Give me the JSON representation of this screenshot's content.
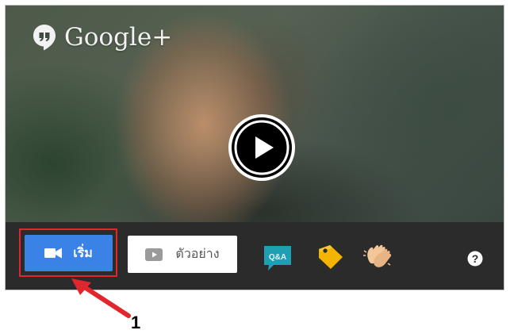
{
  "header": {
    "brand_name": "Google+"
  },
  "video": {
    "play_icon": "play-icon"
  },
  "toolbar": {
    "start_button": {
      "label": "เริ่ม",
      "icon": "video-camera-icon",
      "color": "#3b82e6"
    },
    "sample_button": {
      "label": "ตัวอย่าง",
      "icon": "youtube-play-icon"
    },
    "apps": [
      {
        "icon": "qa-icon",
        "text": "Q&A"
      },
      {
        "icon": "tag-icon"
      },
      {
        "icon": "clapping-hands-icon"
      }
    ],
    "help_icon": "help-icon"
  },
  "annotation": {
    "number": "1",
    "color": "#e1272d"
  }
}
